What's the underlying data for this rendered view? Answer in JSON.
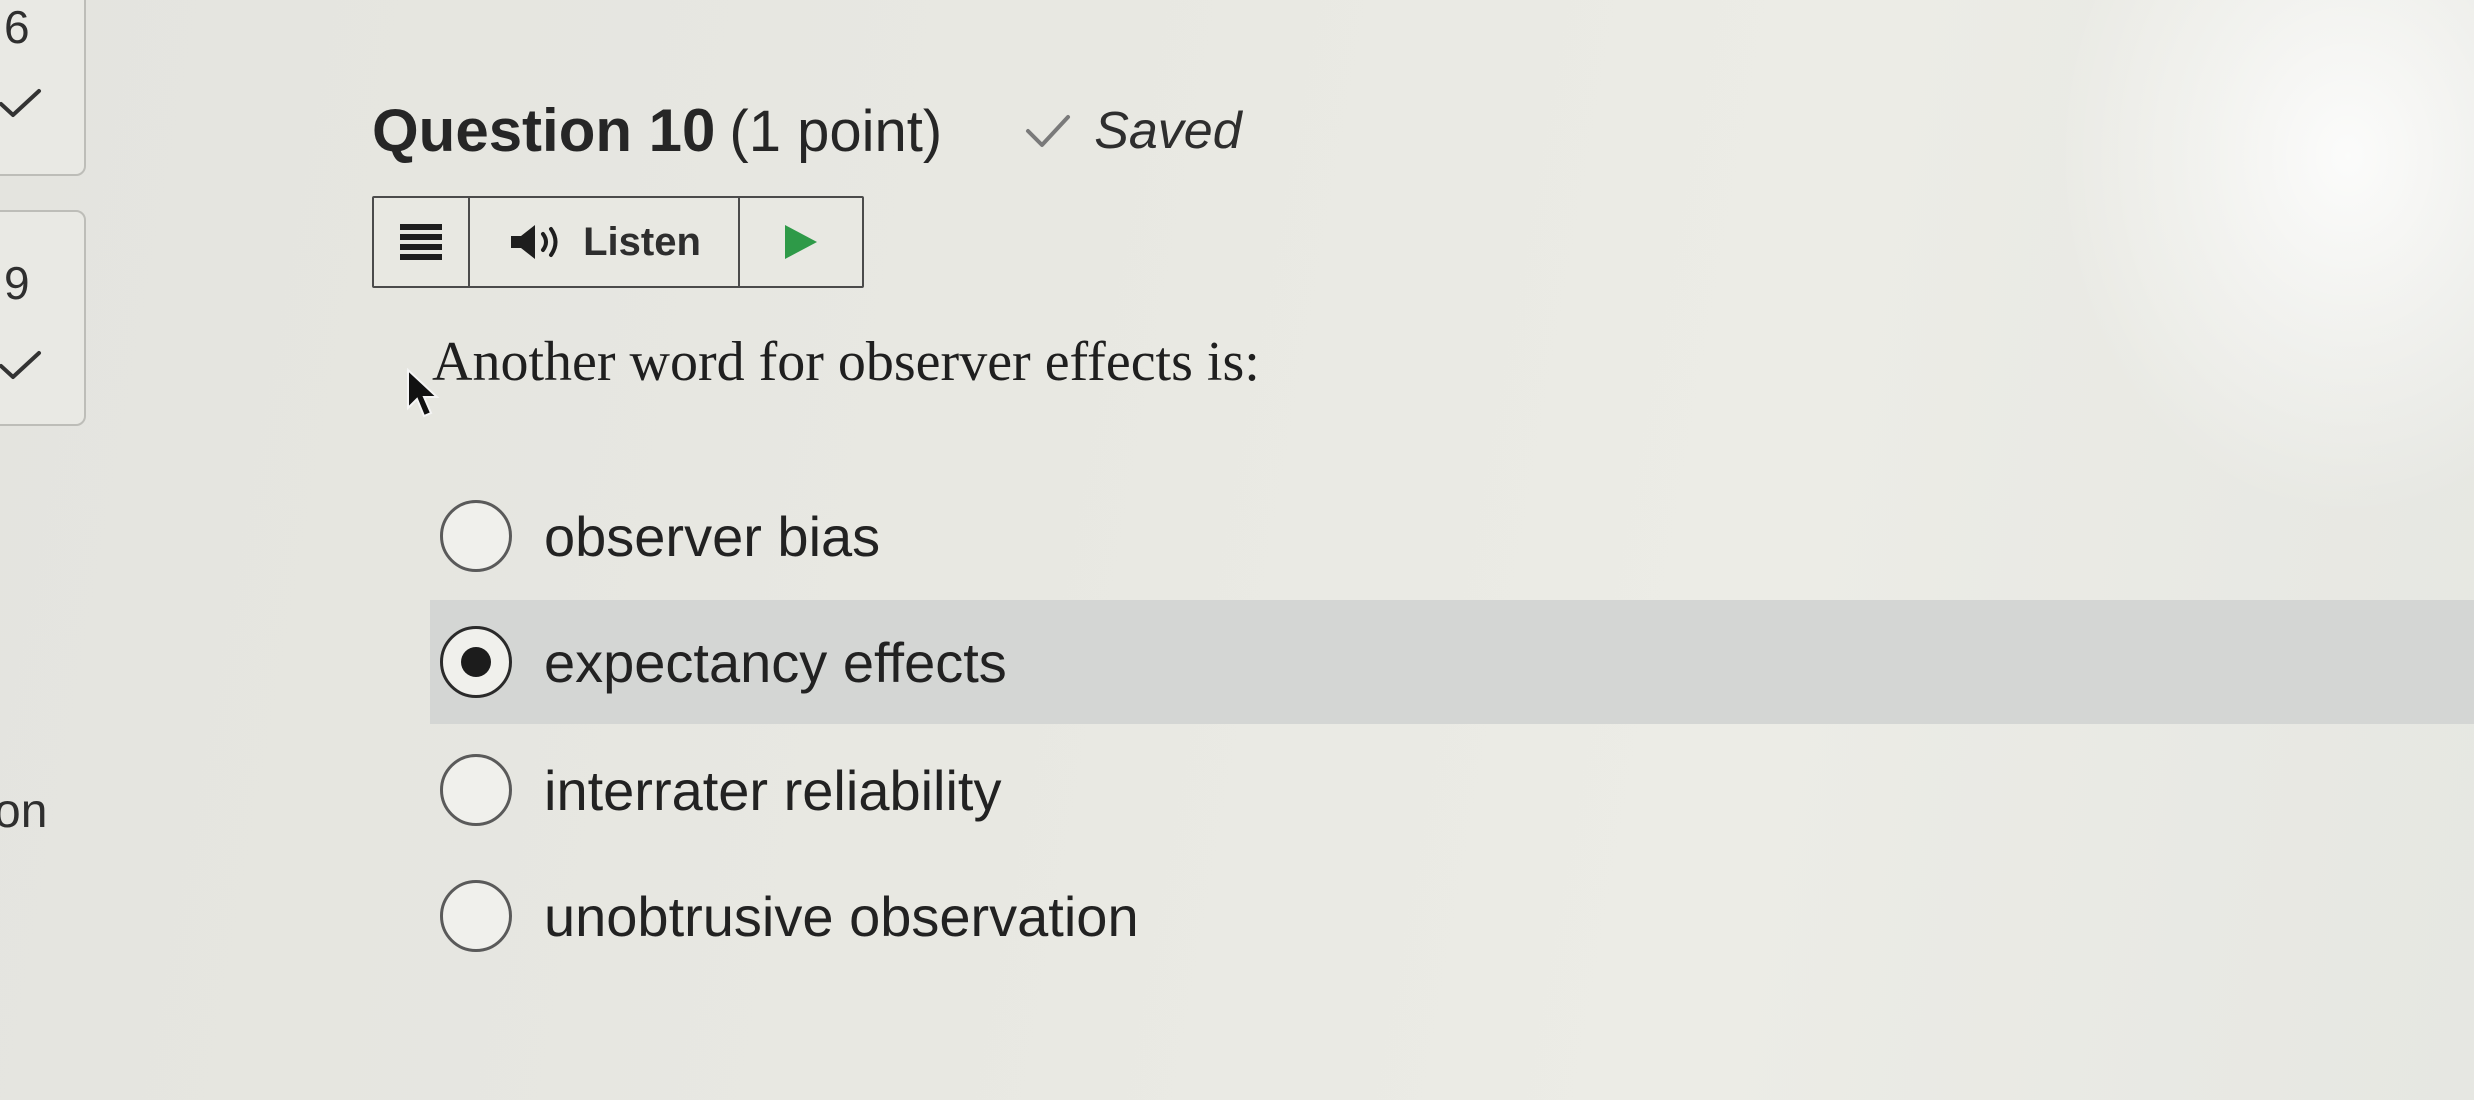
{
  "navigator": {
    "items": [
      {
        "number": "6",
        "status": "answered"
      },
      {
        "number": "9",
        "status": "answered"
      }
    ],
    "side_text": "on"
  },
  "question": {
    "title": "Question 10",
    "points": "(1 point)",
    "saved_label": "Saved",
    "text": "Another word for observer effects is:"
  },
  "listen_bar": {
    "listen_label": "Listen"
  },
  "options": [
    {
      "label": "observer bias",
      "selected": false
    },
    {
      "label": "expectancy effects",
      "selected": true
    },
    {
      "label": "interrater reliability",
      "selected": false
    },
    {
      "label": "unobtrusive observation",
      "selected": false
    }
  ],
  "colors": {
    "background": "#e8e8e2",
    "selected_row": "#d4d6d4",
    "text": "#262626"
  }
}
